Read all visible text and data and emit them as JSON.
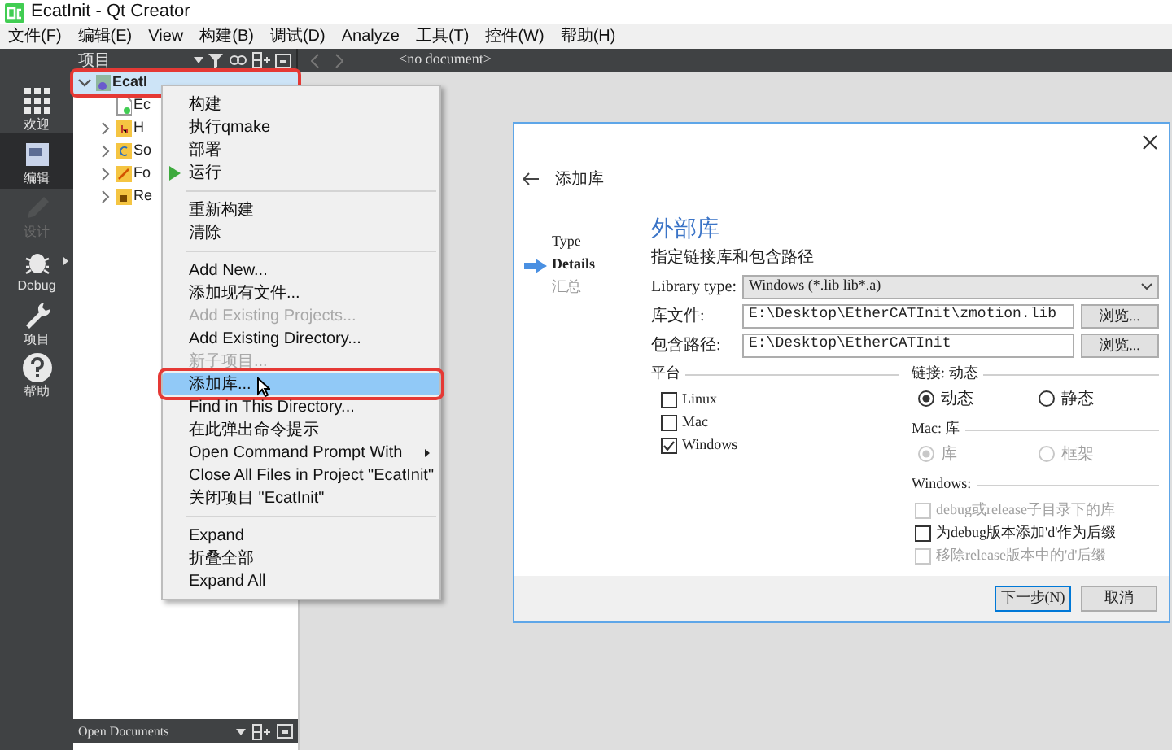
{
  "window": {
    "title": "EcatInit - Qt Creator"
  },
  "menu_bar": [
    "文件(F)",
    "编辑(E)",
    "View",
    "构建(B)",
    "调试(D)",
    "Analyze",
    "工具(T)",
    "控件(W)",
    "帮助(H)"
  ],
  "toolbar": {
    "panel_title": "项目",
    "document": "<no document>"
  },
  "mode_bar": [
    {
      "label": "欢迎",
      "kind": "grid",
      "selected": false,
      "disabled": false
    },
    {
      "label": "编辑",
      "kind": "edit",
      "selected": true,
      "disabled": false
    },
    {
      "label": "设计",
      "kind": "pencil",
      "selected": false,
      "disabled": true
    },
    {
      "label": "Debug",
      "kind": "bug",
      "selected": false,
      "disabled": false
    },
    {
      "label": "项目",
      "kind": "wrench",
      "selected": false,
      "disabled": false
    },
    {
      "label": "帮助",
      "kind": "help",
      "selected": false,
      "disabled": false
    }
  ],
  "project_tree": [
    {
      "label": "EcatI",
      "kind": "project",
      "expanded": true,
      "selected": true,
      "annotated": true,
      "children": [
        {
          "label": "Ec",
          "kind": "file",
          "selected": false,
          "annotated": false
        },
        {
          "label": "H",
          "kind": "headers",
          "expanded": false,
          "selected": false,
          "annotated": false
        },
        {
          "label": "So",
          "kind": "sources",
          "expanded": false,
          "selected": false,
          "annotated": false
        },
        {
          "label": "Fo",
          "kind": "forms",
          "expanded": false,
          "selected": false,
          "annotated": false
        },
        {
          "label": "Re",
          "kind": "resources",
          "expanded": false,
          "selected": false,
          "annotated": false
        }
      ]
    }
  ],
  "context_menu": [
    {
      "kind": "item",
      "label": "构建",
      "disabled": false,
      "selected": false,
      "annotated": false,
      "has_submenu": false
    },
    {
      "kind": "item",
      "label": "执行qmake",
      "disabled": false,
      "selected": false,
      "annotated": false,
      "has_submenu": false
    },
    {
      "kind": "item",
      "label": "部署",
      "disabled": false,
      "selected": false,
      "annotated": false,
      "has_submenu": false
    },
    {
      "kind": "run_item",
      "label": "运行",
      "disabled": false,
      "selected": false,
      "annotated": false,
      "has_submenu": false
    },
    {
      "kind": "separator"
    },
    {
      "kind": "item",
      "label": "重新构建",
      "disabled": false,
      "selected": false,
      "annotated": false,
      "has_submenu": false
    },
    {
      "kind": "item",
      "label": "清除",
      "disabled": false,
      "selected": false,
      "annotated": false,
      "has_submenu": false
    },
    {
      "kind": "separator"
    },
    {
      "kind": "item",
      "label": "Add New...",
      "disabled": false,
      "selected": false,
      "annotated": false,
      "has_submenu": false
    },
    {
      "kind": "item",
      "label": "添加现有文件...",
      "disabled": false,
      "selected": false,
      "annotated": false,
      "has_submenu": false
    },
    {
      "kind": "item",
      "label": "Add Existing Projects...",
      "disabled": true,
      "selected": false,
      "annotated": false,
      "has_submenu": false
    },
    {
      "kind": "item",
      "label": "Add Existing Directory...",
      "disabled": false,
      "selected": false,
      "annotated": false,
      "has_submenu": false
    },
    {
      "kind": "item",
      "label": "新子项目...",
      "disabled": true,
      "selected": false,
      "annotated": false,
      "has_submenu": false
    },
    {
      "kind": "item",
      "label": "添加库...",
      "disabled": false,
      "selected": true,
      "annotated": true,
      "has_submenu": false
    },
    {
      "kind": "item",
      "label": "Find in This Directory...",
      "disabled": false,
      "selected": false,
      "annotated": false,
      "has_submenu": false
    },
    {
      "kind": "item",
      "label": "在此弹出命令提示",
      "disabled": false,
      "selected": false,
      "annotated": false,
      "has_submenu": false
    },
    {
      "kind": "item",
      "label": "Open Command Prompt With",
      "disabled": false,
      "selected": false,
      "annotated": false,
      "has_submenu": true
    },
    {
      "kind": "item",
      "label": "Close All Files in Project \"EcatInit\"",
      "disabled": false,
      "selected": false,
      "annotated": false,
      "has_submenu": false
    },
    {
      "kind": "item",
      "label": "关闭项目 \"EcatInit\"",
      "disabled": false,
      "selected": false,
      "annotated": false,
      "has_submenu": false
    },
    {
      "kind": "separator"
    },
    {
      "kind": "item",
      "label": "Expand",
      "disabled": false,
      "selected": false,
      "annotated": false,
      "has_submenu": false
    },
    {
      "kind": "item",
      "label": "折叠全部",
      "disabled": false,
      "selected": false,
      "annotated": false,
      "has_submenu": false
    },
    {
      "kind": "item",
      "label": "Expand All",
      "disabled": false,
      "selected": false,
      "annotated": false,
      "has_submenu": false
    }
  ],
  "open_documents": {
    "title": "Open Documents"
  },
  "dialog": {
    "title": "添加库",
    "steps": [
      {
        "label": "Type",
        "selected": false,
        "reached": true
      },
      {
        "label": "Details",
        "selected": true,
        "reached": true
      },
      {
        "label": "汇总",
        "selected": false,
        "reached": false
      }
    ],
    "heading": "外部库",
    "subtitle": "指定链接库和包含路径",
    "library_type": {
      "label": "Library type:",
      "value": "Windows (*.lib lib*.a)"
    },
    "fields": [
      {
        "label": "库文件:",
        "value": "E:\\Desktop\\EtherCATInit\\zmotion.lib",
        "button": "浏览..."
      },
      {
        "label": "包含路径:",
        "value": "E:\\Desktop\\EtherCATInit",
        "button": "浏览..."
      }
    ],
    "platform": {
      "title": "平台",
      "options": [
        {
          "label": "Linux",
          "checked": false
        },
        {
          "label": "Mac",
          "checked": false
        },
        {
          "label": "Windows",
          "checked": true
        }
      ]
    },
    "linkage": {
      "title": "链接: 动态",
      "options": [
        {
          "label": "动态",
          "selected": true,
          "disabled": false
        },
        {
          "label": "静态",
          "selected": false,
          "disabled": false
        }
      ]
    },
    "mac": {
      "title": "Mac: 库",
      "options": [
        {
          "label": "库",
          "selected": true,
          "disabled": true
        },
        {
          "label": "框架",
          "selected": false,
          "disabled": true
        }
      ]
    },
    "windows": {
      "title": "Windows:",
      "options": [
        {
          "label": "debug或release子目录下的库",
          "checked": false,
          "disabled": true
        },
        {
          "label": "为debug版本添加'd'作为后缀",
          "checked": false,
          "disabled": false
        },
        {
          "label": "移除release版本中的'd'后缀",
          "checked": false,
          "disabled": true
        }
      ]
    },
    "buttons": [
      {
        "label": "下一步(N)",
        "default": true
      },
      {
        "label": "取消",
        "default": false
      }
    ]
  }
}
